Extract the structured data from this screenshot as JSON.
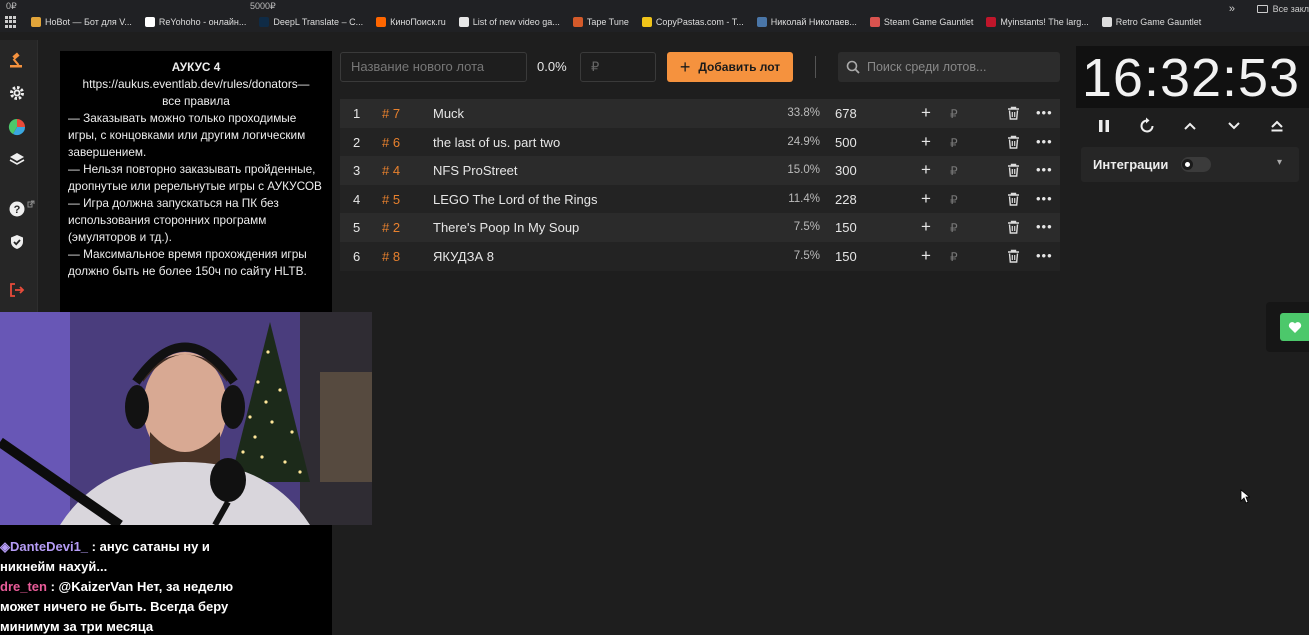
{
  "browser": {
    "top_left_text": "0₽",
    "top_center_text": "5000₽",
    "bookmarks": [
      {
        "label": "HoBot — Бот для V...",
        "color": "#e2a53a"
      },
      {
        "label": "ReYohoho - онлайн...",
        "color": "#ffffff"
      },
      {
        "label": "DeepL Translate – C...",
        "color": "#0f2b46"
      },
      {
        "label": "КиноПоиск.ru",
        "color": "#ff6600"
      },
      {
        "label": "List of new video ga...",
        "color": "#e6e6e6"
      },
      {
        "label": "Tape Tune",
        "color": "#d45a2a"
      },
      {
        "label": "CopyPastas.com - T...",
        "color": "#f0c419"
      },
      {
        "label": "Николай Николаев...",
        "color": "#4a76a8"
      },
      {
        "label": "Steam Game Gauntlet",
        "color": "#d9534f"
      },
      {
        "label": "Myinstants! The larg...",
        "color": "#c0162b"
      },
      {
        "label": "Retro Game Gauntlet",
        "color": "#dddddd"
      }
    ],
    "more_label": "»",
    "folder_label": "Все закл"
  },
  "sidebar": {
    "items": [
      "gavel-icon",
      "gear-icon",
      "pie-chart-icon",
      "layers-icon",
      "help-icon",
      "shield-check-icon",
      "logout-icon"
    ]
  },
  "rules": {
    "title": "АУКУС 4",
    "link": "https://aukus.eventlab.dev/rules/donators—",
    "link_tail": "все правила",
    "lines": [
      "— Заказывать можно только проходимые игры, с концовками или другим логическим завершением.",
      "— Нельзя повторно заказывать пройденные, дропнутые или ререльнутые игры с АУКУСОВ",
      "— Игра должна запускаться на ПК без использования сторонних программ (эмуляторов и тд.).",
      "— Максимальное время прохождения игры должно быть не более 150ч по сайту HLTB."
    ]
  },
  "chat": {
    "messages": [
      {
        "user": "DanteDevi1_",
        "sep": " : ",
        "text": "анус сатаны ну и"
      },
      {
        "user": "",
        "sep": "",
        "text": "никнейм нахуй..."
      },
      {
        "user": "dre_ten",
        "sep": " : ",
        "text": "@KaizerVan Нет, за неделю"
      },
      {
        "user": "",
        "sep": "",
        "text": "может ничего не быть. Всегда беру"
      },
      {
        "user": "",
        "sep": "",
        "text": "минимум за три месяца"
      }
    ]
  },
  "toolbar": {
    "lot_name_placeholder": "Название нового лота",
    "percent": "0.0%",
    "amount_placeholder": "₽",
    "add_button": "Добавить лот",
    "search_placeholder": "Поиск среди лотов..."
  },
  "lots": [
    {
      "index": "1",
      "fast_id": "# 7",
      "name": "Muck",
      "percent": "33.8%",
      "amount": "678"
    },
    {
      "index": "2",
      "fast_id": "# 6",
      "name": "the last of us. part two",
      "percent": "24.9%",
      "amount": "500"
    },
    {
      "index": "3",
      "fast_id": "# 4",
      "name": "NFS ProStreet",
      "percent": "15.0%",
      "amount": "300"
    },
    {
      "index": "4",
      "fast_id": "# 5",
      "name": "LEGO The Lord of the Rings",
      "percent": "11.4%",
      "amount": "228"
    },
    {
      "index": "5",
      "fast_id": "# 2",
      "name": "There's Poop In My Soup",
      "percent": "7.5%",
      "amount": "150"
    },
    {
      "index": "6",
      "fast_id": "# 8",
      "name": "ЯКУДЗА 8",
      "percent": "7.5%",
      "amount": "150"
    }
  ],
  "lot_row_labels": {
    "plus": "+",
    "currency": "₽",
    "more": "•••"
  },
  "timer": {
    "value": "16:32:53",
    "controls": [
      "pause-icon",
      "reset-icon",
      "chevron-up-icon",
      "chevron-down-icon",
      "eject-icon"
    ]
  },
  "integrations": {
    "label": "Интеграции",
    "toggle_on": false
  },
  "colors": {
    "accent": "#f5923e",
    "fast_id": "#e8812e",
    "favorite": "#4cc86b"
  }
}
